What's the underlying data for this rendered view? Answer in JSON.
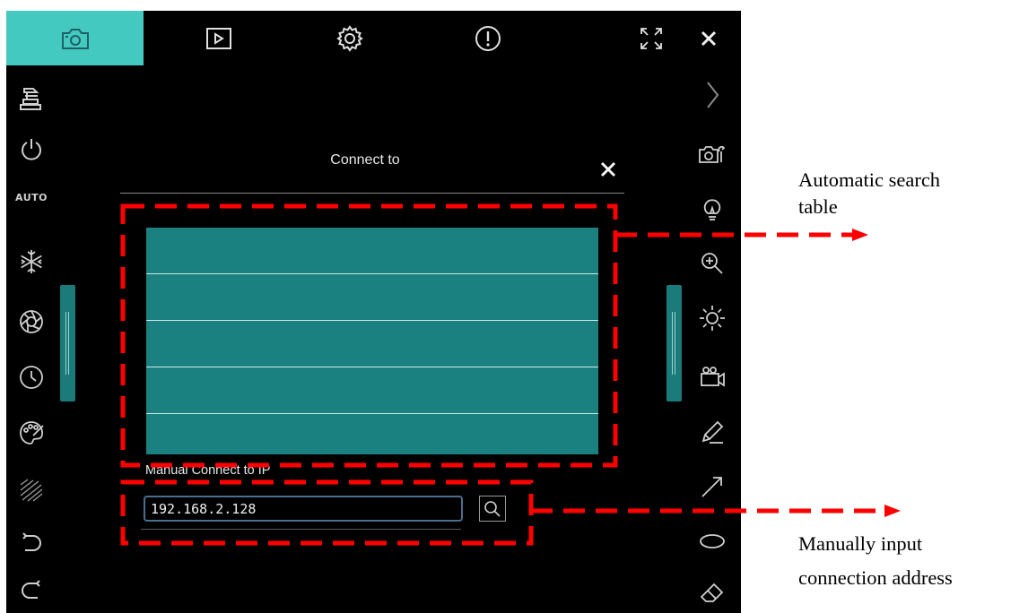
{
  "toolbar": {
    "items": [
      {
        "icon": "camera-icon",
        "active": true
      },
      {
        "icon": "play-icon"
      },
      {
        "icon": "gear-icon"
      },
      {
        "icon": "info-icon"
      }
    ],
    "right": [
      {
        "icon": "fullscreen-icon"
      },
      {
        "icon": "close-icon"
      }
    ]
  },
  "left_sidebar": {
    "items": [
      "document-camera-icon",
      "power-icon",
      "auto-label",
      "snowflake-icon",
      "aperture-icon",
      "clock-icon",
      "palette-icon",
      "pattern-icon",
      "undo-icon",
      "redo-icon"
    ],
    "auto_label": "AUTO"
  },
  "right_sidebar": {
    "items": [
      "chevron-right-icon",
      "camera-settings-icon",
      "bulb-icon",
      "zoom-icon",
      "brightness-icon",
      "video-camera-icon",
      "pen-icon",
      "arrow-icon",
      "ellipse-icon",
      "eraser-icon"
    ]
  },
  "dialog": {
    "title": "Connect to",
    "rows": [
      "",
      "",
      "",
      "",
      ""
    ],
    "manual_label": "Manual Connect to IP",
    "ip_value": "192.168.2.128"
  },
  "annotations": {
    "table_line1": "Automatic search",
    "table_line2": "table",
    "manual_line1": "Manually input",
    "manual_line2": "connection address"
  },
  "colors": {
    "accent": "#43c9bf",
    "table": "#1b8080",
    "annotation": "#ff0000"
  }
}
